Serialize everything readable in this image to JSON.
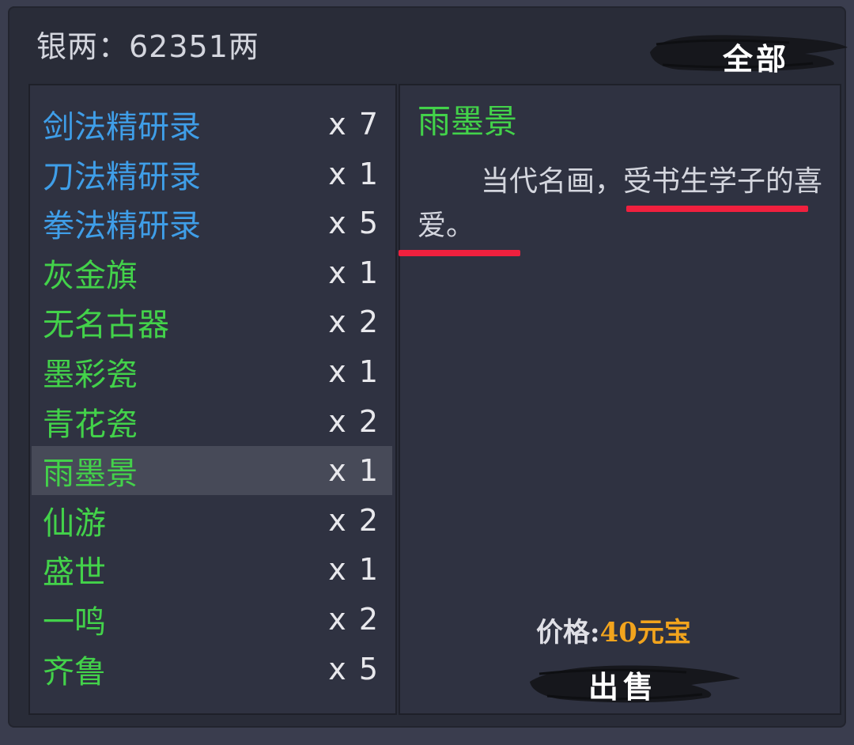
{
  "header": {
    "silver_text": "银两：62351两",
    "filter_label": "全部"
  },
  "inventory": {
    "items": [
      {
        "name": "剑法精研录",
        "qty": "x 7",
        "color": "#3f9ee8",
        "selected": false
      },
      {
        "name": "刀法精研录",
        "qty": "x 1",
        "color": "#3f9ee8",
        "selected": false
      },
      {
        "name": "拳法精研录",
        "qty": "x 5",
        "color": "#3f9ee8",
        "selected": false
      },
      {
        "name": "灰金旗",
        "qty": "x 1",
        "color": "#43d24a",
        "selected": false
      },
      {
        "name": "无名古器",
        "qty": "x 2",
        "color": "#43d24a",
        "selected": false
      },
      {
        "name": "墨彩瓷",
        "qty": "x 1",
        "color": "#43d24a",
        "selected": false
      },
      {
        "name": "青花瓷",
        "qty": "x 2",
        "color": "#43d24a",
        "selected": false
      },
      {
        "name": "雨墨景",
        "qty": "x 1",
        "color": "#43d24a",
        "selected": true
      },
      {
        "name": "仙游",
        "qty": "x 2",
        "color": "#43d24a",
        "selected": false
      },
      {
        "name": "盛世",
        "qty": "x 1",
        "color": "#43d24a",
        "selected": false
      },
      {
        "name": "一鸣",
        "qty": "x 2",
        "color": "#43d24a",
        "selected": false
      },
      {
        "name": "齐鲁",
        "qty": "x 5",
        "color": "#43d24a",
        "selected": false
      }
    ]
  },
  "detail": {
    "title": "雨墨景",
    "description": "当代名画，受书生学子的喜爱。",
    "price_label": "价格:",
    "price_value": "40元宝",
    "sell_label": "出售"
  },
  "colors": {
    "blue_item": "#3f9ee8",
    "green_item": "#43d24a",
    "price": "#f2a41d",
    "annotation_underline": "#f0203e"
  }
}
